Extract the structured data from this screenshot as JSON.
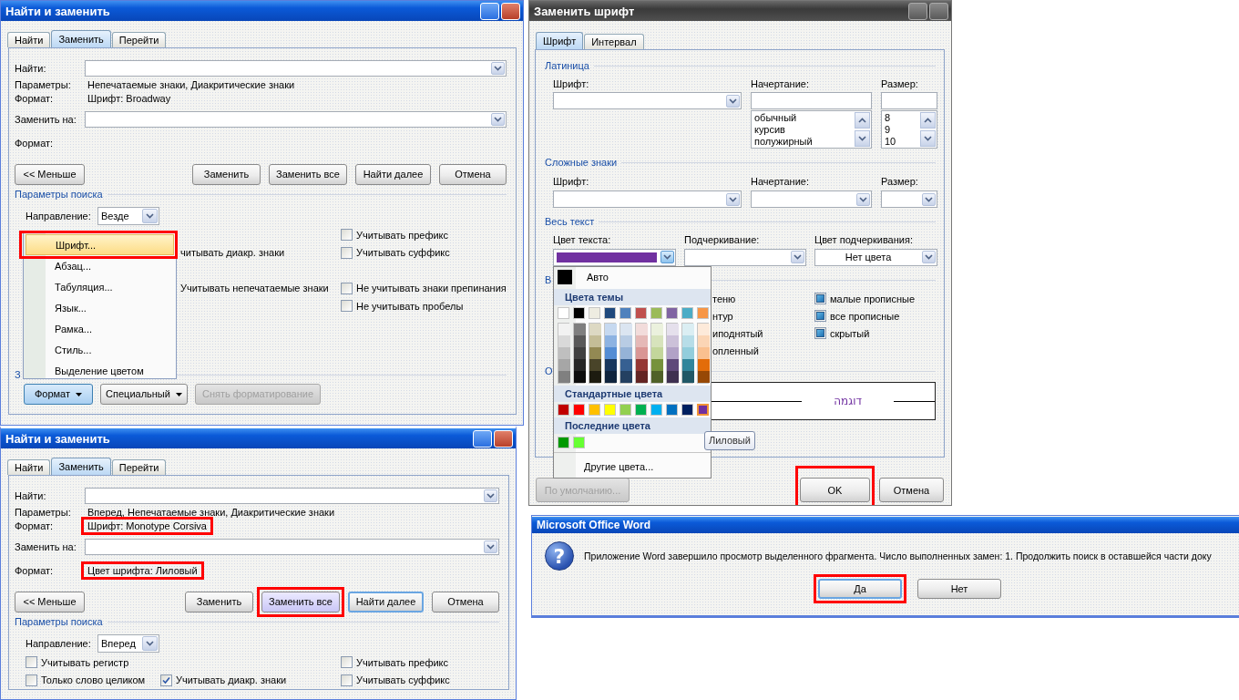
{
  "find_replace_dialogs": [
    {
      "title": "Найти и заменить",
      "tabs": [
        {
          "label": "Найти",
          "selected": false
        },
        {
          "label": "Заменить",
          "selected": true
        },
        {
          "label": "Перейти",
          "selected": false
        }
      ],
      "find_label": "Найти:",
      "params_label": "Параметры:",
      "params": "Непечатаемые знаки, Диакритические знаки",
      "find_format_label": "Формат:",
      "find_format": {
        "text": "Шрифт: Broadway",
        "highlighted": false
      },
      "replace_label": "Заменить на:",
      "replace_format_label": "Формат:",
      "buttons": [
        {
          "label": "<< Меньше",
          "highlighted": false,
          "focused": false
        },
        {
          "label": "Заменить",
          "highlighted": false,
          "focused": false
        },
        {
          "label": "Заменить все",
          "highlighted": false,
          "focused": false
        },
        {
          "label": "Найти далее",
          "highlighted": false,
          "focused": false
        },
        {
          "label": "Отмена",
          "highlighted": false,
          "focused": false
        }
      ],
      "search_options_title": "Параметры поиска",
      "direction_label": "Направление:",
      "direction": "Везде",
      "option_rows": [
        {
          "right": {
            "kind": "checkbox",
            "label": "Учитывать префикс",
            "checked": false
          }
        },
        {
          "middle": {
            "kind": "text",
            "label": "читывать диакр. знаки"
          },
          "right": {
            "kind": "checkbox",
            "label": "Учитывать суффикс",
            "checked": false
          }
        },
        {},
        {
          "middle": {
            "kind": "text",
            "label": "Учитывать непечатаемые знаки"
          },
          "right": {
            "kind": "checkbox",
            "label": "Не учитывать знаки препинания",
            "checked": false
          }
        },
        {
          "right": {
            "kind": "checkbox",
            "label": "Не учитывать пробелы",
            "checked": false
          }
        }
      ],
      "replace_section_title": "З",
      "bottom_buttons": [
        {
          "label": "Формат",
          "kind": "menu",
          "pressed": true,
          "disabled": false
        },
        {
          "label": "Специальный",
          "kind": "menu",
          "pressed": false,
          "disabled": false
        },
        {
          "label": "Снять форматирование",
          "kind": "plain",
          "pressed": false,
          "disabled": true
        }
      ],
      "format_menu": [
        {
          "label": "Шрифт...",
          "selected": true,
          "highlighted": true
        },
        {
          "label": "Абзац...",
          "selected": false,
          "highlighted": false
        },
        {
          "label": "Табуляция...",
          "selected": false,
          "highlighted": false
        },
        {
          "label": "Язык...",
          "selected": false,
          "highlighted": false
        },
        {
          "label": "Рамка...",
          "selected": false,
          "highlighted": false
        },
        {
          "label": "Стиль...",
          "selected": false,
          "highlighted": false
        },
        {
          "label": "Выделение цветом",
          "selected": false,
          "highlighted": false
        }
      ]
    },
    {
      "title": "Найти и заменить",
      "tabs": [
        {
          "label": "Найти",
          "selected": false
        },
        {
          "label": "Заменить",
          "selected": true
        },
        {
          "label": "Перейти",
          "selected": false
        }
      ],
      "find_label": "Найти:",
      "params_label": "Параметры:",
      "params": "Вперед, Непечатаемые знаки, Диакритические знаки",
      "find_format_label": "Формат:",
      "find_format": {
        "text": "Шрифт: Monotype Corsiva",
        "highlighted": true
      },
      "replace_label": "Заменить на:",
      "replace_format_label": "Формат:",
      "replace_format": {
        "text": "Цвет шрифта: Лиловый",
        "highlighted": true
      },
      "buttons": [
        {
          "label": "<< Меньше",
          "highlighted": false,
          "focused": false
        },
        {
          "label": "Заменить",
          "highlighted": false,
          "focused": false
        },
        {
          "label": "Заменить все",
          "highlighted": true,
          "focused": false
        },
        {
          "label": "Найти далее",
          "highlighted": false,
          "focused": true
        },
        {
          "label": "Отмена",
          "highlighted": false,
          "focused": false
        }
      ],
      "search_options_title": "Параметры поиска",
      "direction_label": "Направление:",
      "direction": "Вперед",
      "option_rows": [
        {
          "left": {
            "kind": "checkbox",
            "label": "Учитывать регистр",
            "checked": false
          },
          "right": {
            "kind": "checkbox",
            "label": "Учитывать префикс",
            "checked": false
          }
        },
        {
          "left": {
            "kind": "checkbox",
            "label": "Только слово целиком",
            "checked": false
          },
          "middle": {
            "kind": "checkbox",
            "label": "Учитывать диакр. знаки",
            "checked": true
          },
          "right": {
            "kind": "checkbox",
            "label": "Учитывать суффикс",
            "checked": false
          }
        }
      ]
    }
  ],
  "font_dialog": {
    "title": "Заменить шрифт",
    "tabs": [
      {
        "label": "Шрифт",
        "selected": true
      },
      {
        "label": "Интервал",
        "selected": false
      }
    ],
    "latin": {
      "title": "Латиница",
      "font_label": "Шрифт:",
      "style_label": "Начертание:",
      "size_label": "Размер:",
      "styles": [
        "обычный",
        "курсив",
        "полужирный"
      ],
      "sizes": [
        "8",
        "9",
        "10"
      ]
    },
    "complex": {
      "title": "Сложные знаки",
      "font_label": "Шрифт:",
      "style_label": "Начертание:",
      "size_label": "Размер:"
    },
    "all_text": {
      "title": "Весь текст",
      "text_color_label": "Цвет текста:",
      "underline_label": "Подчеркивание:",
      "underline_color_label": "Цвет подчеркивания:",
      "underline_color": "Нет цвета"
    },
    "effects": {
      "title": "В",
      "rows": [
        {
          "left": "теню",
          "right": {
            "label": "малые прописные",
            "mixed": true
          }
        },
        {
          "left": "нтур",
          "right": {
            "label": "все прописные",
            "mixed": true
          }
        },
        {
          "left": "иподнятый",
          "right": {
            "label": "скрытый",
            "mixed": true
          }
        },
        {
          "left": "опленный"
        }
      ]
    },
    "sample": {
      "title": "О",
      "text": "דוגמה"
    },
    "buttons": [
      {
        "label": "По умолчанию...",
        "disabled": true,
        "highlighted": false
      },
      {
        "label": "OK",
        "disabled": false,
        "highlighted": true
      },
      {
        "label": "Отмена",
        "disabled": false,
        "highlighted": false
      }
    ],
    "color_popup": {
      "auto_label": "Авто",
      "theme_title": "Цвета темы",
      "theme_colors": [
        {
          "color": "#ffffff",
          "selected": false,
          "shades": [
            {
              "color": "#f2f2f2",
              "selected": false
            },
            {
              "color": "#d9d9d9",
              "selected": false
            },
            {
              "color": "#bfbfbf",
              "selected": false
            },
            {
              "color": "#a6a6a6",
              "selected": false
            },
            {
              "color": "#808080",
              "selected": false
            }
          ]
        },
        {
          "color": "#000000",
          "selected": false,
          "shades": [
            {
              "color": "#7f7f7f",
              "selected": false
            },
            {
              "color": "#595959",
              "selected": false
            },
            {
              "color": "#404040",
              "selected": false
            },
            {
              "color": "#262626",
              "selected": false
            },
            {
              "color": "#0d0d0d",
              "selected": false
            }
          ]
        },
        {
          "color": "#eeece1",
          "selected": false,
          "shades": [
            {
              "color": "#ddd9c3",
              "selected": false
            },
            {
              "color": "#c4bd97",
              "selected": false
            },
            {
              "color": "#938953",
              "selected": false
            },
            {
              "color": "#494429",
              "selected": false
            },
            {
              "color": "#1d1b10",
              "selected": false
            }
          ]
        },
        {
          "color": "#1f497d",
          "selected": false,
          "shades": [
            {
              "color": "#c6d9f0",
              "selected": false
            },
            {
              "color": "#8db3e2",
              "selected": false
            },
            {
              "color": "#548dd4",
              "selected": false
            },
            {
              "color": "#17365d",
              "selected": false
            },
            {
              "color": "#0f243e",
              "selected": false
            }
          ]
        },
        {
          "color": "#4f81bd",
          "selected": false,
          "shades": [
            {
              "color": "#dbe5f1",
              "selected": false
            },
            {
              "color": "#b8cce4",
              "selected": false
            },
            {
              "color": "#95b3d7",
              "selected": false
            },
            {
              "color": "#366092",
              "selected": false
            },
            {
              "color": "#244061",
              "selected": false
            }
          ]
        },
        {
          "color": "#c0504d",
          "selected": false,
          "shades": [
            {
              "color": "#f2dcdb",
              "selected": false
            },
            {
              "color": "#e5b9b7",
              "selected": false
            },
            {
              "color": "#d99694",
              "selected": false
            },
            {
              "color": "#953734",
              "selected": false
            },
            {
              "color": "#632423",
              "selected": false
            }
          ]
        },
        {
          "color": "#9bbb59",
          "selected": false,
          "shades": [
            {
              "color": "#ebf1dd",
              "selected": false
            },
            {
              "color": "#d7e3bc",
              "selected": false
            },
            {
              "color": "#c3d69b",
              "selected": false
            },
            {
              "color": "#76923c",
              "selected": false
            },
            {
              "color": "#4f6128",
              "selected": false
            }
          ]
        },
        {
          "color": "#8064a2",
          "selected": false,
          "shades": [
            {
              "color": "#e5e0ec",
              "selected": false
            },
            {
              "color": "#ccc1d9",
              "selected": false
            },
            {
              "color": "#b2a2c7",
              "selected": false
            },
            {
              "color": "#5f497a",
              "selected": false
            },
            {
              "color": "#3f3151",
              "selected": false
            }
          ]
        },
        {
          "color": "#4bacc6",
          "selected": false,
          "shades": [
            {
              "color": "#dbeef3",
              "selected": false
            },
            {
              "color": "#b7dde8",
              "selected": false
            },
            {
              "color": "#92cddc",
              "selected": false
            },
            {
              "color": "#31859b",
              "selected": false
            },
            {
              "color": "#205867",
              "selected": false
            }
          ]
        },
        {
          "color": "#f79646",
          "selected": false,
          "shades": [
            {
              "color": "#fdeada",
              "selected": false
            },
            {
              "color": "#fbd5b5",
              "selected": false
            },
            {
              "color": "#fac08f",
              "selected": false
            },
            {
              "color": "#e36c09",
              "selected": false
            },
            {
              "color": "#974806",
              "selected": false
            }
          ]
        }
      ],
      "standard_title": "Стандартные цвета",
      "standard_colors": [
        {
          "color": "#c00000",
          "selected": false
        },
        {
          "color": "#ff0000",
          "selected": false
        },
        {
          "color": "#ffc000",
          "selected": false
        },
        {
          "color": "#ffff00",
          "selected": false
        },
        {
          "color": "#92d050",
          "selected": false
        },
        {
          "color": "#00b050",
          "selected": false
        },
        {
          "color": "#00b0f0",
          "selected": false
        },
        {
          "color": "#0070c0",
          "selected": false
        },
        {
          "color": "#002060",
          "selected": false
        },
        {
          "color": "#7030a0",
          "selected": true
        }
      ],
      "recent_title": "Последние цвета",
      "recent_colors": [
        {
          "color": "#009900",
          "selected": false
        },
        {
          "color": "#66ff33",
          "selected": false
        }
      ],
      "more_label": "Другие цвета...",
      "tooltip": "Лиловый"
    }
  },
  "message_box": {
    "title": "Microsoft Office Word",
    "icon": "?",
    "text": "Приложение Word завершило просмотр выделенного фрагмента. Число выполненных замен: 1. Продолжить поиск в оставшейся части доку",
    "buttons": [
      {
        "label": "Да",
        "focused": true,
        "highlighted": true
      },
      {
        "label": "Нет",
        "focused": false,
        "highlighted": false
      }
    ]
  }
}
